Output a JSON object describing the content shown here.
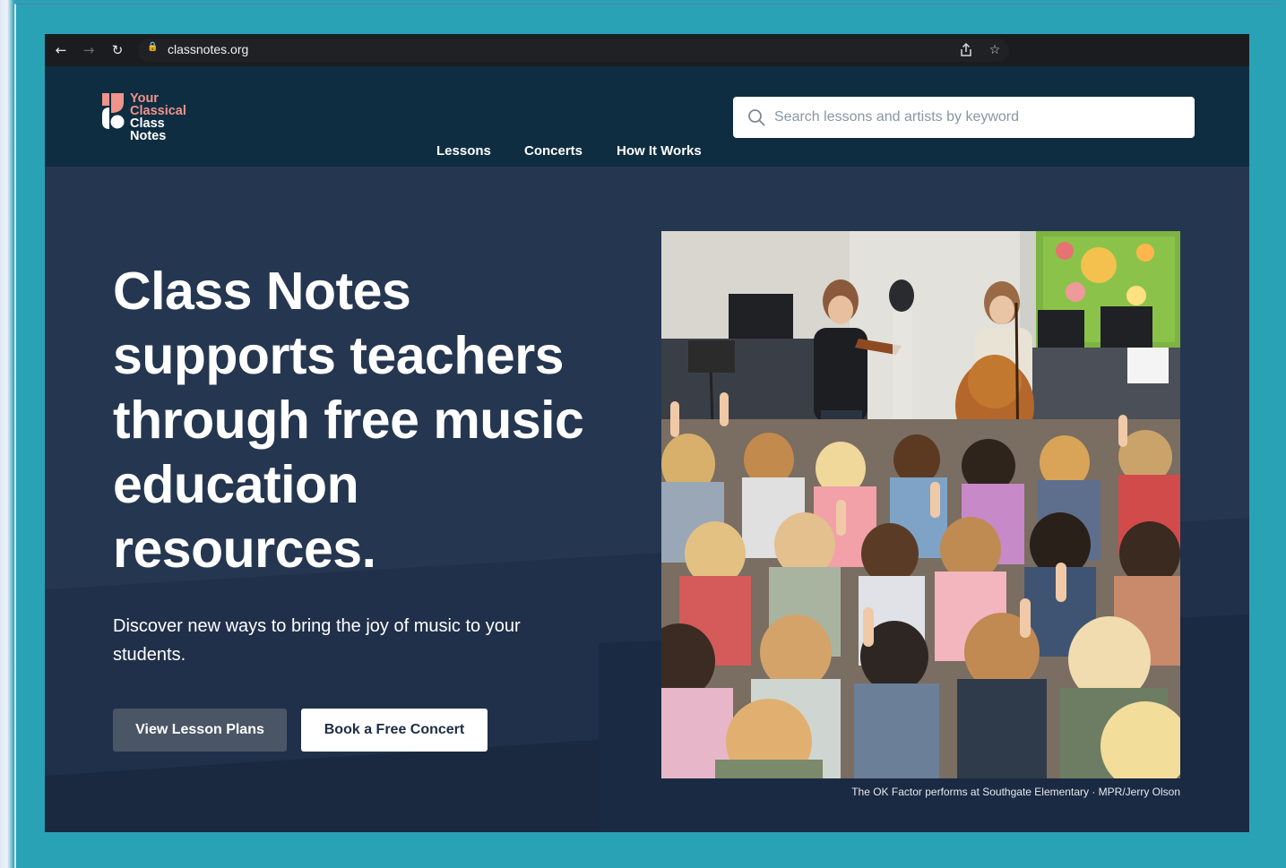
{
  "browser": {
    "url": "classnotes.org",
    "icons": [
      "back-arrow-icon",
      "forward-arrow-icon",
      "reload-icon",
      "lock-icon",
      "share-icon",
      "star-icon"
    ]
  },
  "logo": {
    "line1": "Your",
    "line2": "Classical",
    "line3": "Class",
    "line4": "Notes",
    "accent_color": "#f0938a"
  },
  "nav": {
    "items": [
      {
        "label": "Lessons"
      },
      {
        "label": "Concerts"
      },
      {
        "label": "How It Works"
      }
    ]
  },
  "search": {
    "placeholder": "Search lessons and artists by keyword",
    "value": ""
  },
  "hero": {
    "headline": "Class Notes supports teachers through free music education resources.",
    "subcopy": "Discover new ways to bring the joy of music to your students.",
    "primary_button": "View Lesson Plans",
    "secondary_button": "Book a Free Concert",
    "caption": "The OK Factor performs at Southgate Elementary · MPR/Jerry Olson"
  },
  "colors": {
    "header_bg": "#0f2d41",
    "hero_bg": "#253650",
    "frame_bg": "#2aa2b5"
  }
}
